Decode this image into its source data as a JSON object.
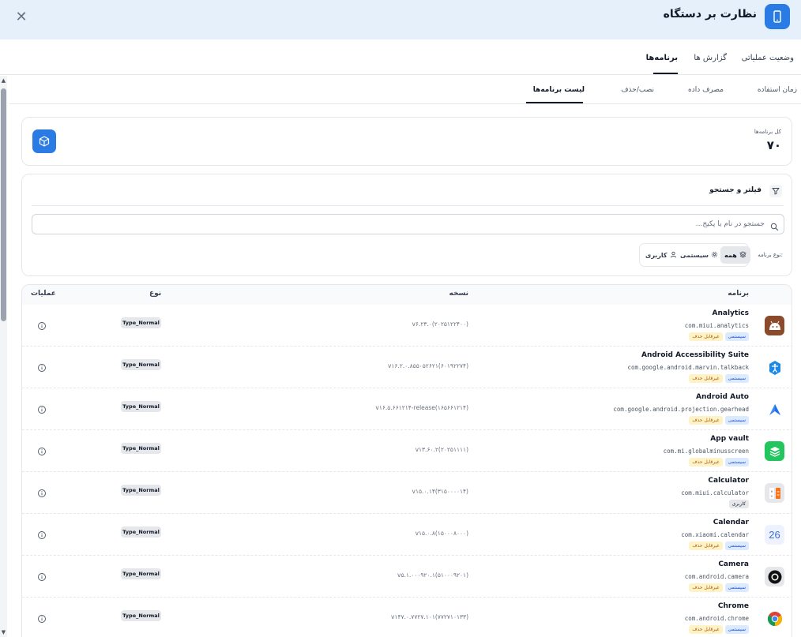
{
  "header": {
    "title": "نظارت بر دستگاه",
    "close_symbol": "✕",
    "icon": "phone-icon",
    "bg_color": "#e6f0fb",
    "accent": "#2b7be4"
  },
  "main_tabs": [
    {
      "label": "وضعیت عملیاتی",
      "active": false
    },
    {
      "label": "گزارش ها",
      "active": false
    },
    {
      "label": "برنامه‌ها",
      "active": true
    }
  ],
  "sub_tabs": [
    {
      "label": "زمان استفاده",
      "active": false
    },
    {
      "label": "مصرف داده",
      "active": false
    },
    {
      "label": "نصب/حذف",
      "active": false
    },
    {
      "label": "لیست برنامه‌ها",
      "active": true
    }
  ],
  "summary": {
    "label": "کل برنامه‌ها",
    "value": "۷۰",
    "icon": "package-icon"
  },
  "filter": {
    "title": "فیلتر و جستجو",
    "icon": "funnel-icon",
    "search_placeholder": "جستجو در نام یا پکیج...",
    "search_value": "",
    "type_label": "نوع برنامه:",
    "segments": [
      {
        "label": "همه",
        "icon": "layers-icon",
        "active": true
      },
      {
        "label": "سیستمی",
        "icon": "gear-icon",
        "active": false
      },
      {
        "label": "کاربری",
        "icon": "user-icon",
        "active": false
      }
    ]
  },
  "table": {
    "headers": {
      "app": "برنامه",
      "version": "نسخه",
      "type": "نوع",
      "actions": "عملیات"
    },
    "rows": [
      {
        "name": "Analytics",
        "package": "com.miui.analytics",
        "version": "v۶.۲۳.۰(۲۰۲۵۱۲۲۴۰۰)",
        "type": "Type_Normal",
        "badges": [
          {
            "label": "سیستمی",
            "kind": "system"
          },
          {
            "label": "غیرقابل حذف",
            "kind": "nonremovable"
          }
        ],
        "icon": "analytics-icon"
      },
      {
        "name": "Android Accessibility Suite",
        "package": "com.google.android.marvin.talkback",
        "version": "v۱۶.۲.۰.۸۵۵۰۵۲۶۲۱(۶۰۱۹۲۲۷۴)",
        "type": "Type_Normal",
        "badges": [
          {
            "label": "سیستمی",
            "kind": "system"
          },
          {
            "label": "غیرقابل حذف",
            "kind": "nonremovable"
          }
        ],
        "icon": "accessibility-icon"
      },
      {
        "name": "Android Auto",
        "package": "com.google.android.projection.gearhead",
        "version": "v۱۶.۵.۶۶۱۲۱۴-release(۱۶۵۶۶۱۲۱۴)",
        "type": "Type_Normal",
        "badges": [
          {
            "label": "سیستمی",
            "kind": "system"
          },
          {
            "label": "غیرقابل حذف",
            "kind": "nonremovable"
          }
        ],
        "icon": "android-auto-icon"
      },
      {
        "name": "App vault",
        "package": "com.mi.globalminusscreen",
        "version": "v۱۳.۶۰.۲(۲۰۲۵۱۱۱۱)",
        "type": "Type_Normal",
        "badges": [
          {
            "label": "سیستمی",
            "kind": "system"
          },
          {
            "label": "غیرقابل حذف",
            "kind": "nonremovable"
          }
        ],
        "icon": "app-vault-icon"
      },
      {
        "name": "Calculator",
        "package": "com.miui.calculator",
        "version": "v۱۵.۰.۱۴(۳۱۵۰۰۰۰۱۴)",
        "type": "Type_Normal",
        "badges": [
          {
            "label": "کاربری",
            "kind": "user"
          }
        ],
        "icon": "calculator-icon"
      },
      {
        "name": "Calendar",
        "package": "com.xiaomi.calendar",
        "version": "v۱۵.۰.۸(۱۵۰۰۰۸۰۰۰)",
        "type": "Type_Normal",
        "badges": [
          {
            "label": "سیستمی",
            "kind": "system"
          },
          {
            "label": "غیرقابل حذف",
            "kind": "nonremovable"
          }
        ],
        "icon": "calendar-icon",
        "icon_text": "26"
      },
      {
        "name": "Camera",
        "package": "com.android.camera",
        "version": "v۵.۱.۰۰۰۹۲۰.۱(۵۱۰۰۰۹۲۰۱)",
        "type": "Type_Normal",
        "badges": [
          {
            "label": "سیستمی",
            "kind": "system"
          },
          {
            "label": "غیرقابل حذف",
            "kind": "nonremovable"
          }
        ],
        "icon": "camera-icon"
      },
      {
        "name": "Chrome",
        "package": "com.android.chrome",
        "version": "v۱۴۷.۰.۷۷۲۷.۱۰۱(۷۷۲۷۱۰۱۳۳)",
        "type": "Type_Normal",
        "badges": [
          {
            "label": "سیستمی",
            "kind": "system"
          },
          {
            "label": "غیرقابل حذف",
            "kind": "nonremovable"
          }
        ],
        "icon": "chrome-icon"
      }
    ]
  }
}
